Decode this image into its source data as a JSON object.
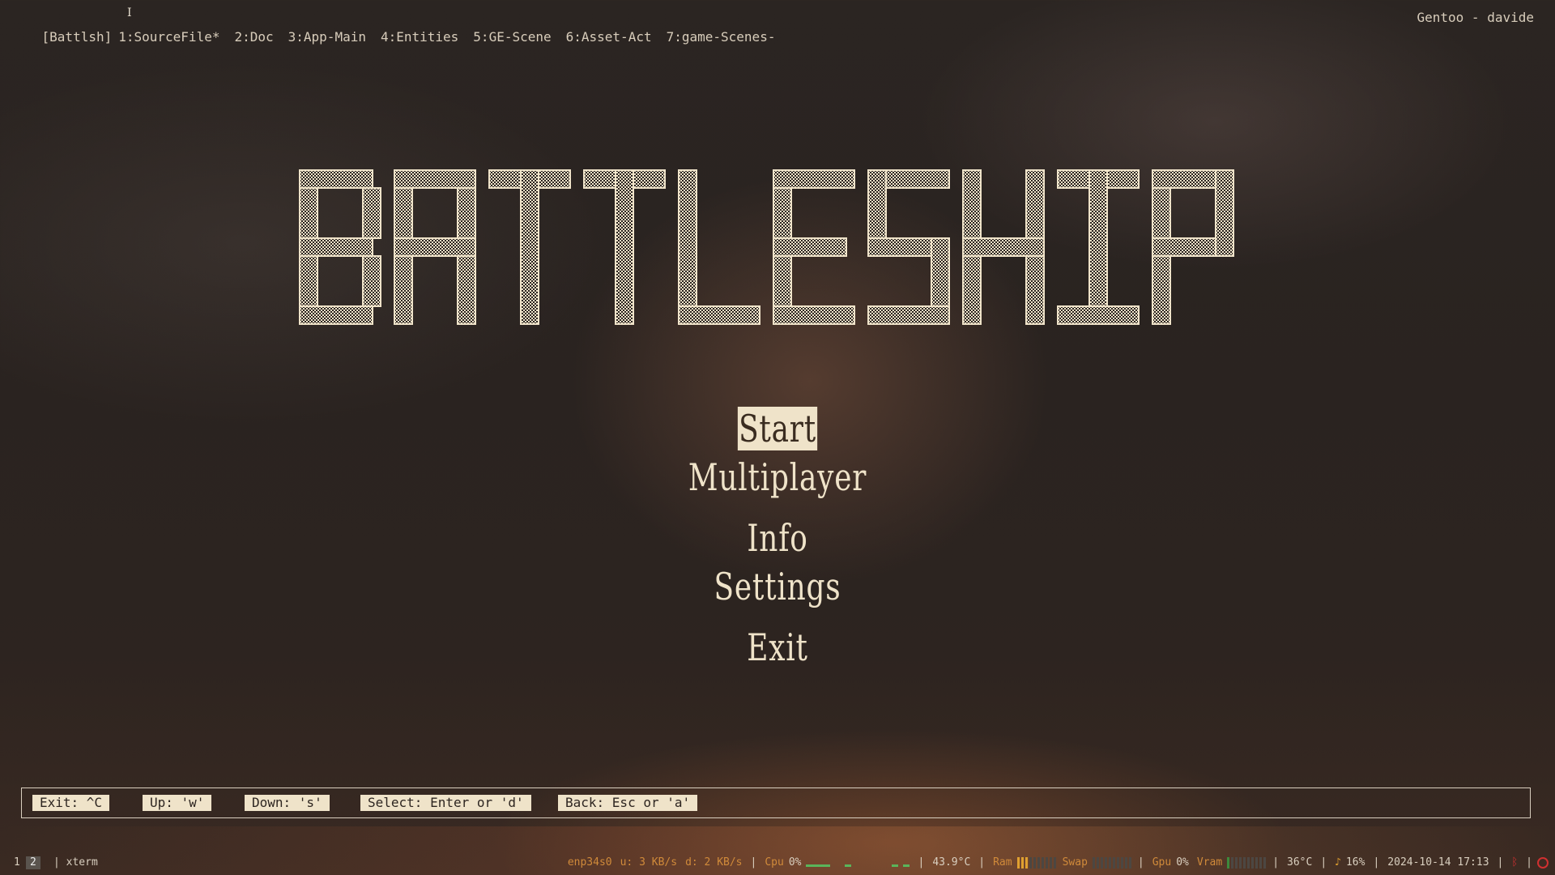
{
  "topbar": {
    "session": "[Battlsh]",
    "tabs": [
      "1:SourceFile*",
      "2:Doc",
      "3:App-Main",
      "4:Entities",
      "5:GE-Scene",
      "6:Asset-Act",
      "7:game-Scenes-"
    ],
    "host": "Gentoo - davide"
  },
  "game": {
    "title_logo": "BATTLESHIP",
    "menu": [
      {
        "label": "Start",
        "selected": true
      },
      {
        "label": "Multiplayer",
        "selected": false
      },
      {
        "label": "Info",
        "selected": false
      },
      {
        "label": "Settings",
        "selected": false
      },
      {
        "label": "Exit",
        "selected": false
      }
    ]
  },
  "helpbar": {
    "keys": [
      "Exit: ^C",
      "Up: 'w'",
      "Down: 's'",
      "Select: Enter or 'd'",
      "Back: Esc or 'a'"
    ]
  },
  "statusbar": {
    "workspaces": [
      "1",
      "2"
    ],
    "active_workspace": "2",
    "window": "xterm",
    "net_iface": "enp34s0",
    "net_up": "u: 3 KB/s",
    "net_down": "d: 2 KB/s",
    "cpu_label": "Cpu",
    "cpu_value": "0%",
    "cpu_temp": "43.9°C",
    "ram_label": "Ram",
    "ram_level": 0.25,
    "swap_label": "Swap",
    "swap_level": 0,
    "gpu_label": "Gpu",
    "gpu_value": "0%",
    "vram_label": "Vram",
    "vram_level": 0.05,
    "gpu_temp": "36°C",
    "volume": "16%",
    "datetime": "2024-10-14 17:13",
    "icons": [
      "music-note-icon",
      "bluetooth-icon",
      "power-icon"
    ]
  },
  "colors": {
    "accent_cream": "#efe3c9",
    "status_orange": "#d08a3a",
    "alert_red": "#d03030",
    "graph_green": "#3c8a3c"
  }
}
